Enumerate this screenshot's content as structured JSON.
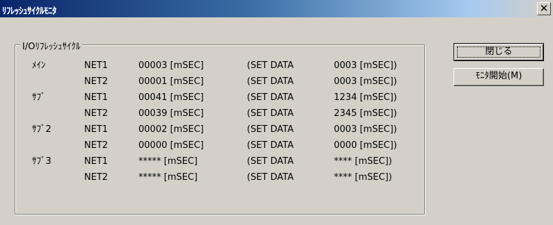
{
  "window": {
    "title": "ﾘﾌﾚｯｼｭｻｲｸﾙﾓﾆﾀ",
    "close_glyph": "✕"
  },
  "group": {
    "label": "I/Oﾘﾌﾚｯｼｭｻｲｸﾙ"
  },
  "rows": [
    {
      "label": "ﾒｲﾝ",
      "net": "NET1",
      "value": "00003 [mSEC]",
      "set": "(SET DATA",
      "set_value": "0003 [mSEC])"
    },
    {
      "label": "",
      "net": "NET2",
      "value": "00001 [mSEC]",
      "set": "(SET DATA",
      "set_value": "0003 [mSEC])"
    },
    {
      "label": "ｻﾌﾞ",
      "net": "NET1",
      "value": "00041 [mSEC]",
      "set": "(SET DATA",
      "set_value": "1234 [mSEC])"
    },
    {
      "label": "",
      "net": "NET2",
      "value": "00039 [mSEC]",
      "set": "(SET DATA",
      "set_value": "2345 [mSEC])"
    },
    {
      "label": "ｻﾌﾞ2",
      "net": "NET1",
      "value": "00002 [mSEC]",
      "set": "(SET DATA",
      "set_value": "0003 [mSEC])"
    },
    {
      "label": "",
      "net": "NET2",
      "value": "00000 [mSEC]",
      "set": "(SET DATA",
      "set_value": "0000 [mSEC])"
    },
    {
      "label": "ｻﾌﾞ3",
      "net": "NET1",
      "value": "***** [mSEC]",
      "set": "(SET DATA",
      "set_value": "**** [mSEC])"
    },
    {
      "label": "",
      "net": "NET2",
      "value": "***** [mSEC]",
      "set": "(SET DATA",
      "set_value": "**** [mSEC])"
    }
  ],
  "buttons": {
    "close_label": "閉じる",
    "monitor_label": "ﾓﾆﾀ開始(M)"
  }
}
